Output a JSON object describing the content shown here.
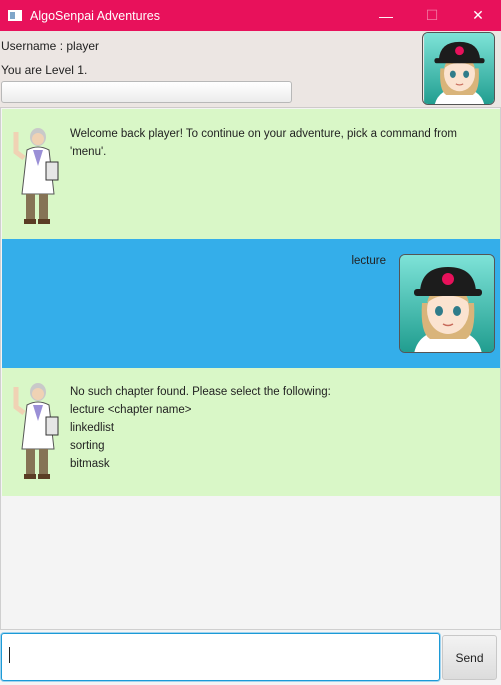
{
  "window": {
    "title": "AlgoSenpai Adventures",
    "minimize_glyph": "—",
    "maximize_glyph": "☐",
    "close_glyph": "✕"
  },
  "header": {
    "username_text": "Username : player",
    "level_text": "You are Level 1.",
    "progress": 0,
    "avatar_icon": "player-avatar-icon"
  },
  "messages": [
    {
      "sender": "bot",
      "avatar_icon": "professor-sprite-icon",
      "text": "Welcome back player! To continue on your adventure, pick a command from 'menu'."
    },
    {
      "sender": "user",
      "avatar_icon": "player-avatar-icon",
      "text": "lecture"
    },
    {
      "sender": "bot",
      "avatar_icon": "professor-sprite-icon",
      "text": "No such chapter found. Please select the following:\nlecture <chapter name>\nlinkedlist\nsorting\nbitmask"
    }
  ],
  "input": {
    "value": "",
    "placeholder": ""
  },
  "send_button": {
    "label": "Send"
  },
  "colors": {
    "titlebar": "#e8115b",
    "bot_bubble": "#d9f7c7",
    "user_bubble": "#34aeea",
    "header_bg": "#ece6e3"
  }
}
